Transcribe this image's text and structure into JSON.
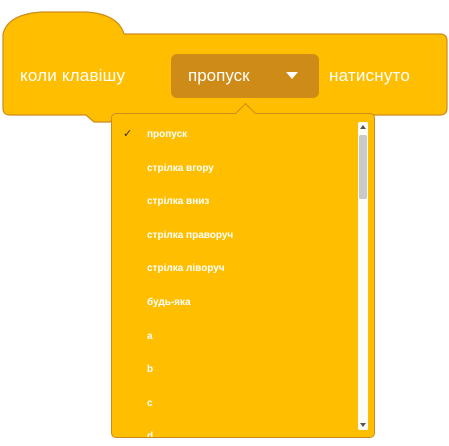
{
  "block": {
    "prefix": "коли клавішу",
    "selected_key": "пропуск",
    "suffix": "натиснуто"
  },
  "menu": {
    "items": [
      {
        "label": "пропуск",
        "selected": true
      },
      {
        "label": "стрілка вгору",
        "selected": false
      },
      {
        "label": "стрілка вниз",
        "selected": false
      },
      {
        "label": "стрілка праворуч",
        "selected": false
      },
      {
        "label": "стрілка ліворуч",
        "selected": false
      },
      {
        "label": "будь-яка",
        "selected": false
      },
      {
        "label": "a",
        "selected": false
      },
      {
        "label": "b",
        "selected": false
      },
      {
        "label": "c",
        "selected": false
      },
      {
        "label": "d",
        "selected": false
      }
    ],
    "check_icon": "✓",
    "scroll_position": 0
  },
  "colors": {
    "block_fill": "#ffbf00",
    "block_border": "#cf8b17",
    "dropdown_fill": "#cf8b17",
    "text": "#ffffff"
  },
  "icons": {
    "dropdown": "chevron-down-icon",
    "check": "check-icon",
    "scroll_up": "scroll-up-icon",
    "scroll_down": "scroll-down-icon"
  }
}
